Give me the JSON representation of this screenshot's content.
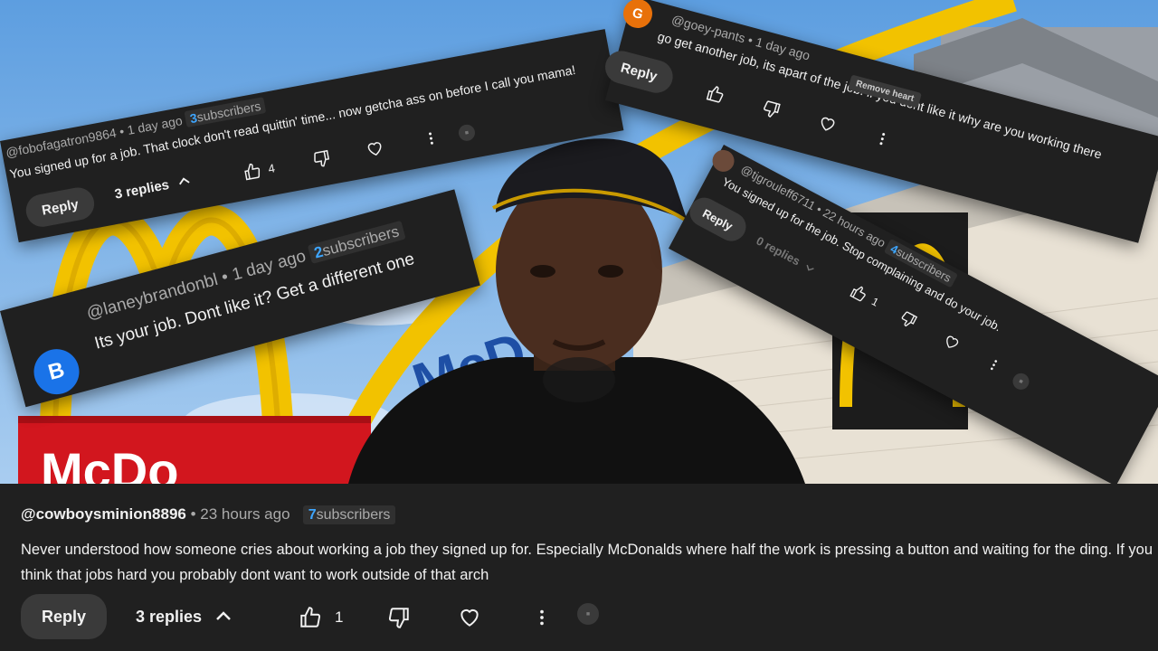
{
  "comments": {
    "c1": {
      "handle": "@fobofagatron9864",
      "time": "1 day ago",
      "subs_count": "3",
      "subs_label": "subscribers",
      "text": "You signed up for a job. That clock don't read quittin' time... now getcha ass on before I call you mama!",
      "reply": "Reply",
      "replies": "3 replies",
      "likes": "4"
    },
    "c2": {
      "handle": "@laneybrandonbl",
      "time": "1 day ago",
      "subs_count": "2",
      "subs_label": "subscribers",
      "text": "Its your job. Dont like it? Get a different one",
      "avatar_letter": "B",
      "avatar_color": "#1a73e8"
    },
    "c3": {
      "handle": "@goey-pants",
      "time": "1 day ago",
      "text": "go get another job, its apart of the job. if you dont like it why are you working there",
      "reply": "Reply",
      "remove_heart": "Remove heart",
      "avatar_letter": "G",
      "avatar_color": "#e8710a"
    },
    "c4": {
      "handle": "@tjgrouleff6711",
      "time": "22 hours ago",
      "subs_count": "4",
      "subs_label": "subscribers",
      "text": "You signed up for the job. Stop complaining and do your job.",
      "reply": "Reply",
      "replies": "0 replies",
      "likes": "1"
    },
    "main": {
      "handle": "@cowboysminion8896",
      "time": "23 hours ago",
      "subs_count": "7",
      "subs_label": "subscribers",
      "text": "Never understood how someone cries about working a job they signed up for. Especially McDonalds where half the work is pressing a button and waiting for the ding. If you think that jobs hard you probably dont want to work outside of that arch",
      "reply": "Reply",
      "replies": "3 replies",
      "likes": "1"
    }
  },
  "background": {
    "sign_text_large": "McDo",
    "sign_text_building": "McD",
    "sky_color": "#7fb3e6",
    "arch_color": "#f2c200",
    "sign_red": "#d2161e"
  }
}
